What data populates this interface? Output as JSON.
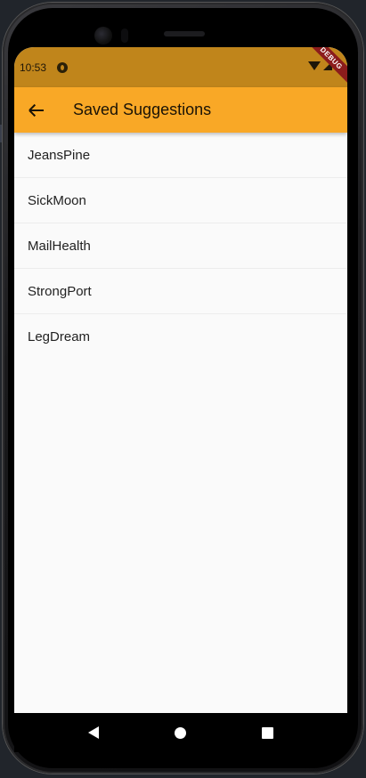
{
  "status_bar": {
    "time": "10:53"
  },
  "debug_banner": "DEBUG",
  "app_bar": {
    "title": "Saved Suggestions",
    "back_icon": "arrow-left-icon"
  },
  "saved_suggestions": [
    "JeansPine",
    "SickMoon",
    "MailHealth",
    "StrongPort",
    "LegDream"
  ],
  "nav_bar": {
    "back_icon": "triangle-back-icon",
    "home_icon": "circle-home-icon",
    "recents_icon": "square-recents-icon"
  },
  "colors": {
    "app_bar": "#f9a826",
    "status_bar": "#c0851b",
    "background": "#fafafa",
    "debug_banner": "#8b1c1c"
  }
}
